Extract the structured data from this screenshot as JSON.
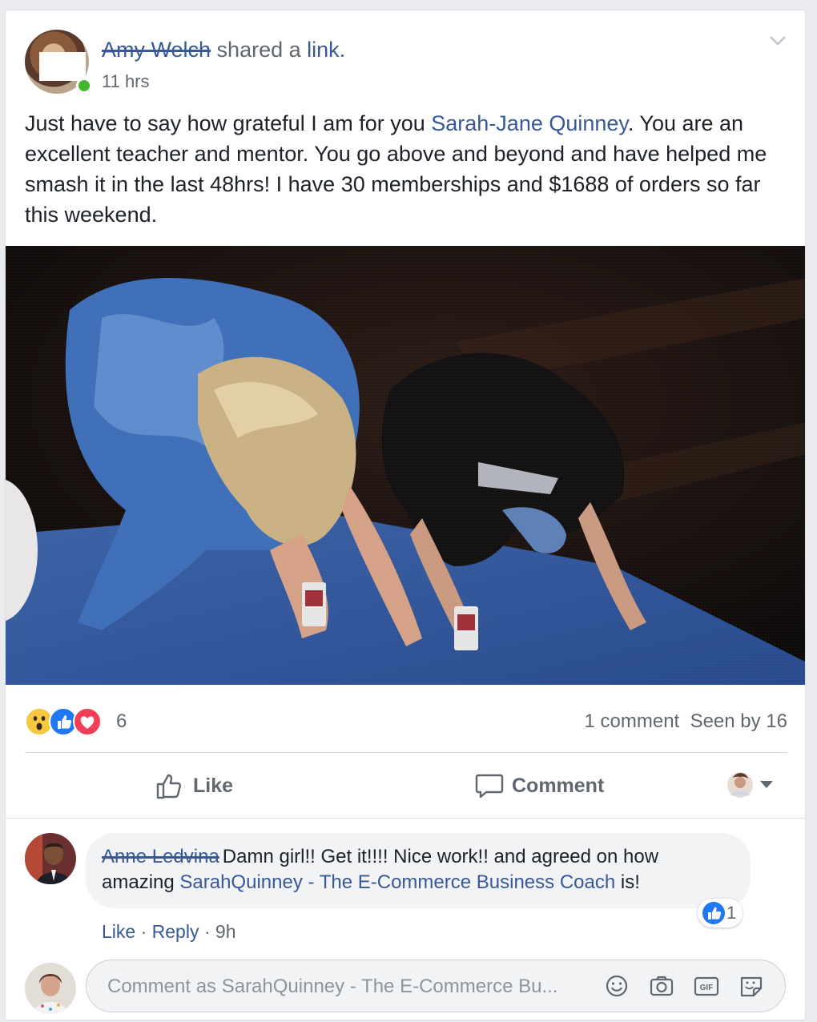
{
  "post": {
    "author_name": "Amy Welch",
    "shared_text": "shared a",
    "link_label": "link.",
    "time": "11 hrs",
    "text_before_mention": "Just have to say how grateful I am for you ",
    "mention": "Sarah-Jane Quinney",
    "text_after_mention": ". You are an excellent teacher and mentor. You go above and beyond and have helped me smash it in the last 48hrs! I have 30 memberships and $1688 of orders so far this weekend."
  },
  "stats": {
    "reaction_count": "6",
    "comments": "1 comment",
    "seen_by": "Seen by 16"
  },
  "actions": {
    "like": "Like",
    "comment": "Comment"
  },
  "comment": {
    "author_name": "Anne Ledvina",
    "text_before": "Damn girl!! Get it!!!! Nice work!! and agreed on how amazing ",
    "mention": "SarahQuinney - The E-Commerce Business Coach",
    "text_after": " is!",
    "like_count": "1",
    "like_label": "Like",
    "reply_label": "Reply",
    "time": "9h",
    "separator": "·"
  },
  "composer": {
    "placeholder": "Comment as SarahQuinney - The E-Commerce Bu..."
  },
  "colors": {
    "link": "#385898",
    "like_blue": "#2078f4",
    "love_red": "#f33e58",
    "wow_yellow": "#f7c742"
  }
}
